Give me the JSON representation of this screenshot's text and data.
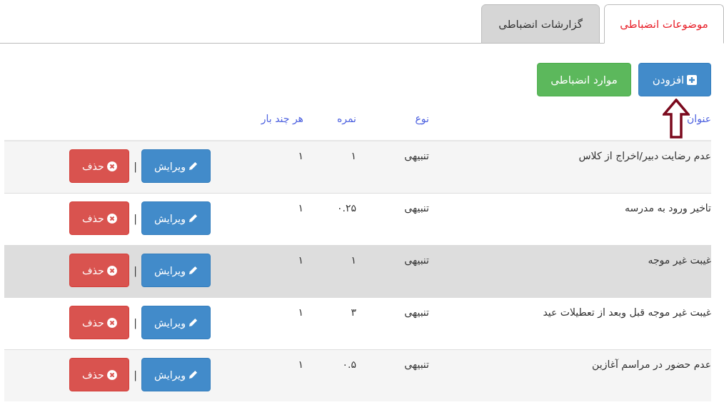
{
  "tabs": [
    {
      "label": "موضوعات انضباطی",
      "selected": true
    },
    {
      "label": "گزارشات انضباطی",
      "selected": false
    }
  ],
  "toolbar": {
    "add_button": "افزودن",
    "items_button": "موارد انضباطی"
  },
  "table": {
    "columns": [
      "عنوان",
      "نوع",
      "نمره",
      "هر چند بار"
    ],
    "rows": [
      {
        "title": "عدم رضایت دبیر/اخراج از کلاس",
        "type": "تنبیهی",
        "score": "۱",
        "count": "۱",
        "edit": "ویرایش",
        "separator": "|",
        "delete": "حذف",
        "hovered": false
      },
      {
        "title": "تاخیر ورود به مدرسه",
        "type": "تنبیهی",
        "score": "۰.۲۵",
        "count": "۱",
        "edit": "ویرایش",
        "separator": "|",
        "delete": "حذف",
        "hovered": false
      },
      {
        "title": "غیبت غیر موجه",
        "type": "تنبیهی",
        "score": "۱",
        "count": "۱",
        "edit": "ویرایش",
        "separator": "|",
        "delete": "حذف",
        "hovered": true
      },
      {
        "title": "غیبت غیر موجه قبل وبعد از تعطیلات عید",
        "type": "تنبیهی",
        "score": "۳",
        "count": "۱",
        "edit": "ویرایش",
        "separator": "|",
        "delete": "حذف",
        "hovered": false
      },
      {
        "title": "عدم حضور در مراسم آغازین",
        "type": "تنبیهی",
        "score": "۰.۵",
        "count": "۱",
        "edit": "ویرایش",
        "separator": "|",
        "delete": "حذف",
        "hovered": false
      }
    ]
  }
}
